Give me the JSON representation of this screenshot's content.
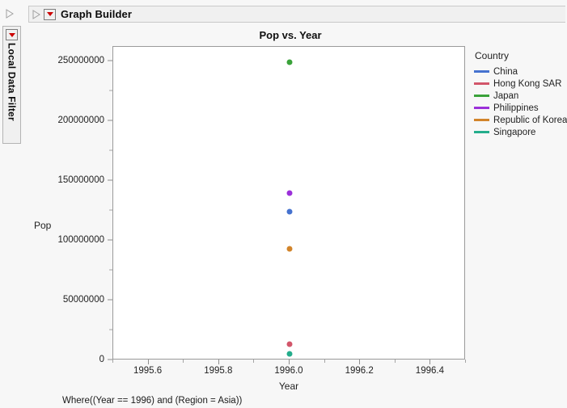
{
  "window": {
    "panel_title": "Graph Builder",
    "disclosure_icon": "triangle-right-icon",
    "red_menu_icon": "red-dropdown-triangle-icon"
  },
  "sidebar": {
    "label": "Local Data Filter",
    "red_menu_icon": "red-dropdown-triangle-icon",
    "expander_icon": "triangle-right-icon"
  },
  "footer": {
    "where_clause": "Where((Year == 1996) and (Region = Asia))"
  },
  "legend": {
    "title": "Country",
    "items": [
      {
        "label": "China",
        "color": "#4572cf"
      },
      {
        "label": "Hong Kong SAR",
        "color": "#d2566a"
      },
      {
        "label": "Japan",
        "color": "#3aa23a"
      },
      {
        "label": "Philippines",
        "color": "#9b30d9"
      },
      {
        "label": "Republic of Korea",
        "color": "#d2842a"
      },
      {
        "label": "Singapore",
        "color": "#24ad8c"
      }
    ]
  },
  "chart_data": {
    "type": "scatter",
    "title": "Pop vs. Year",
    "xlabel": "Year",
    "ylabel": "Pop",
    "xlim": [
      1995.5,
      1996.5
    ],
    "ylim": [
      0,
      262000000
    ],
    "grid": false,
    "legend_position": "right",
    "x_ticks": [
      {
        "value": 1995.6,
        "label": "1995.6"
      },
      {
        "value": 1995.8,
        "label": "1995.8"
      },
      {
        "value": 1996.0,
        "label": "1996.0"
      },
      {
        "value": 1996.2,
        "label": "1996.2"
      },
      {
        "value": 1996.4,
        "label": "1996.4"
      }
    ],
    "x_minor_ticks": [
      1995.5,
      1995.7,
      1995.9,
      1996.1,
      1996.3,
      1996.5
    ],
    "y_ticks": [
      {
        "value": 0,
        "label": "0"
      },
      {
        "value": 50000000,
        "label": "50000000"
      },
      {
        "value": 100000000,
        "label": "100000000"
      },
      {
        "value": 150000000,
        "label": "150000000"
      },
      {
        "value": 200000000,
        "label": "200000000"
      },
      {
        "value": 250000000,
        "label": "250000000"
      }
    ],
    "y_minor_ticks": [
      25000000,
      75000000,
      125000000,
      175000000,
      225000000
    ],
    "series": [
      {
        "name": "Japan",
        "color": "#3aa23a",
        "points": [
          {
            "x": 1996.0,
            "y": 249000000
          }
        ]
      },
      {
        "name": "Philippines",
        "color": "#9b30d9",
        "points": [
          {
            "x": 1996.0,
            "y": 140000000
          }
        ]
      },
      {
        "name": "China",
        "color": "#4572cf",
        "points": [
          {
            "x": 1996.0,
            "y": 124000000
          }
        ]
      },
      {
        "name": "Republic of Korea",
        "color": "#d2842a",
        "points": [
          {
            "x": 1996.0,
            "y": 93000000
          }
        ]
      },
      {
        "name": "Hong Kong SAR",
        "color": "#d2566a",
        "points": [
          {
            "x": 1996.0,
            "y": 13500000
          }
        ]
      },
      {
        "name": "Singapore",
        "color": "#24ad8c",
        "points": [
          {
            "x": 1996.0,
            "y": 5500000
          }
        ]
      }
    ]
  }
}
